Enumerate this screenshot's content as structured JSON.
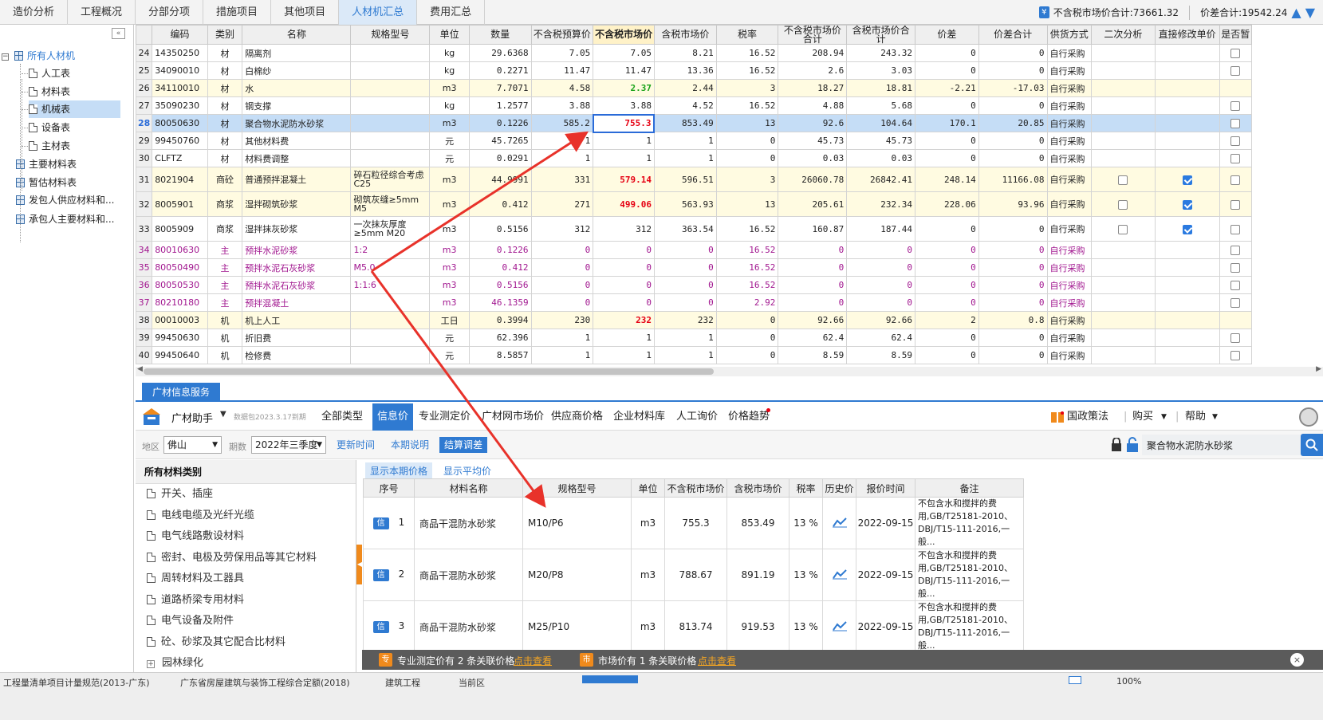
{
  "top_tabs": [
    "造价分析",
    "工程概况",
    "分部分项",
    "措施项目",
    "其他项目",
    "人材机汇总",
    "费用汇总"
  ],
  "active_top_tab": "人材机汇总",
  "totals": {
    "icon": "¥",
    "pre_tax_label": "不含税市场价合计:73661.32",
    "diff_label": "价差合计:19542.24"
  },
  "tree": {
    "collapse": "«",
    "items": [
      {
        "label": "所有人材机",
        "level": 0,
        "root": true,
        "toggle": "−"
      },
      {
        "label": "人工表",
        "level": 1
      },
      {
        "label": "材料表",
        "level": 1
      },
      {
        "label": "机械表",
        "level": 1,
        "selected": true
      },
      {
        "label": "设备表",
        "level": 1
      },
      {
        "label": "主材表",
        "level": 1
      },
      {
        "label": "主要材料表",
        "level": 0
      },
      {
        "label": "暂估材料表",
        "level": 0
      },
      {
        "label": "发包人供应材料和...",
        "level": 0
      },
      {
        "label": "承包人主要材料和...",
        "level": 0
      }
    ]
  },
  "grid": {
    "headers": [
      "",
      "编码",
      "类别",
      "名称",
      "规格型号",
      "单位",
      "数量",
      "不含税预算价",
      "不含税市场价",
      "含税市场价",
      "税率",
      "不含税市场价合计",
      "含税市场价合计",
      "价差",
      "价差合计",
      "供货方式",
      "二次分析",
      "直接修改单价",
      "是否暂"
    ],
    "rows": [
      {
        "n": "24",
        "code": "14350250",
        "cat": "材",
        "name": "隔离剂",
        "spec": "",
        "unit": "kg",
        "qty": "29.6368",
        "bud": "7.05",
        "mkt": "7.05",
        "tmkt": "8.21",
        "tax": "16.52",
        "sum": "208.94",
        "tsum": "243.32",
        "diff": "0",
        "dsum": "0",
        "supply": "自行采购",
        "cb2": "",
        "cb3": "",
        "style": ""
      },
      {
        "n": "25",
        "code": "34090010",
        "cat": "材",
        "name": "白棉纱",
        "spec": "",
        "unit": "kg",
        "qty": "0.2271",
        "bud": "11.47",
        "mkt": "11.47",
        "tmkt": "13.36",
        "tax": "16.52",
        "sum": "2.6",
        "tsum": "3.03",
        "diff": "0",
        "dsum": "0",
        "supply": "自行采购",
        "cb2": "",
        "cb3": "",
        "style": ""
      },
      {
        "n": "26",
        "code": "34110010",
        "cat": "材",
        "name": "水",
        "spec": "",
        "unit": "m3",
        "qty": "7.7071",
        "bud": "4.58",
        "mkt": "2.37",
        "tmkt": "2.44",
        "tax": "3",
        "sum": "18.27",
        "tsum": "18.81",
        "diff": "-2.21",
        "dsum": "-17.03",
        "supply": "自行采购",
        "cb2": "",
        "cb3": "",
        "style": "y",
        "mk": "green"
      },
      {
        "n": "27",
        "code": "35090230",
        "cat": "材",
        "name": "钢支撑",
        "spec": "",
        "unit": "kg",
        "qty": "1.2577",
        "bud": "3.88",
        "mkt": "3.88",
        "tmkt": "4.52",
        "tax": "16.52",
        "sum": "4.88",
        "tsum": "5.68",
        "diff": "0",
        "dsum": "0",
        "supply": "自行采购",
        "cb2": "",
        "cb3": "",
        "style": ""
      },
      {
        "n": "28",
        "code": "80050630",
        "cat": "材",
        "name": "聚合物水泥防水砂浆",
        "spec": "",
        "unit": "m3",
        "qty": "0.1226",
        "bud": "585.2",
        "mkt": "755.3",
        "tmkt": "853.49",
        "tax": "13",
        "sum": "92.6",
        "tsum": "104.64",
        "diff": "170.1",
        "dsum": "20.85",
        "supply": "自行采购",
        "cb2": "",
        "cb3": "",
        "style": "sel",
        "mk": "red"
      },
      {
        "n": "29",
        "code": "99450760",
        "cat": "材",
        "name": "其他材料费",
        "spec": "",
        "unit": "元",
        "qty": "45.7265",
        "bud": "1",
        "mkt": "1",
        "tmkt": "1",
        "tax": "0",
        "sum": "45.73",
        "tsum": "45.73",
        "diff": "0",
        "dsum": "0",
        "supply": "自行采购",
        "cb2": "",
        "cb3": "",
        "style": ""
      },
      {
        "n": "30",
        "code": "CLFTZ",
        "cat": "材",
        "name": "材料费调整",
        "spec": "",
        "unit": "元",
        "qty": "0.0291",
        "bud": "1",
        "mkt": "1",
        "tmkt": "1",
        "tax": "0",
        "sum": "0.03",
        "tsum": "0.03",
        "diff": "0",
        "dsum": "0",
        "supply": "自行采购",
        "cb2": "",
        "cb3": "",
        "style": ""
      },
      {
        "n": "31",
        "code": "8021904",
        "cat": "商砼",
        "name": "普通预拌混凝土",
        "spec": "碎石粒径综合考虑 C25",
        "unit": "m3",
        "qty": "44.9991",
        "bud": "331",
        "mkt": "579.14",
        "tmkt": "596.51",
        "tax": "3",
        "sum": "26060.78",
        "tsum": "26842.41",
        "diff": "248.14",
        "dsum": "11166.08",
        "supply": "自行采购",
        "cb2": "off",
        "cb3": "on",
        "style": "y tall",
        "mk": "red"
      },
      {
        "n": "32",
        "code": "8005901",
        "cat": "商浆",
        "name": "湿拌砌筑砂浆",
        "spec": "砌筑灰缝≥5mm M5",
        "unit": "m3",
        "qty": "0.412",
        "bud": "271",
        "mkt": "499.06",
        "tmkt": "563.93",
        "tax": "13",
        "sum": "205.61",
        "tsum": "232.34",
        "diff": "228.06",
        "dsum": "93.96",
        "supply": "自行采购",
        "cb2": "off",
        "cb3": "on",
        "style": "y tall",
        "mk": "red"
      },
      {
        "n": "33",
        "code": "8005909",
        "cat": "商浆",
        "name": "湿拌抹灰砂浆",
        "spec": "一次抹灰厚度≥5mm M20",
        "unit": "m3",
        "qty": "0.5156",
        "bud": "312",
        "mkt": "312",
        "tmkt": "363.54",
        "tax": "16.52",
        "sum": "160.87",
        "tsum": "187.44",
        "diff": "0",
        "dsum": "0",
        "supply": "自行采购",
        "cb2": "off",
        "cb3": "on",
        "style": "tall"
      },
      {
        "n": "34",
        "code": "80010630",
        "cat": "主",
        "name": "预拌水泥砂浆",
        "spec": "1:2",
        "unit": "m3",
        "qty": "0.1226",
        "bud": "0",
        "mkt": "0",
        "tmkt": "0",
        "tax": "16.52",
        "sum": "0",
        "tsum": "0",
        "diff": "0",
        "dsum": "0",
        "supply": "自行采购",
        "cb2": "",
        "cb3": "",
        "style": "main"
      },
      {
        "n": "35",
        "code": "80050490",
        "cat": "主",
        "name": "预拌水泥石灰砂浆",
        "spec": "M5.0",
        "unit": "m3",
        "qty": "0.412",
        "bud": "0",
        "mkt": "0",
        "tmkt": "0",
        "tax": "16.52",
        "sum": "0",
        "tsum": "0",
        "diff": "0",
        "dsum": "0",
        "supply": "自行采购",
        "cb2": "",
        "cb3": "",
        "style": "main"
      },
      {
        "n": "36",
        "code": "80050530",
        "cat": "主",
        "name": "预拌水泥石灰砂浆",
        "spec": "1:1:6",
        "unit": "m3",
        "qty": "0.5156",
        "bud": "0",
        "mkt": "0",
        "tmkt": "0",
        "tax": "16.52",
        "sum": "0",
        "tsum": "0",
        "diff": "0",
        "dsum": "0",
        "supply": "自行采购",
        "cb2": "",
        "cb3": "",
        "style": "main"
      },
      {
        "n": "37",
        "code": "80210180",
        "cat": "主",
        "name": "预拌混凝土",
        "spec": "",
        "unit": "m3",
        "qty": "46.1359",
        "bud": "0",
        "mkt": "0",
        "tmkt": "0",
        "tax": "2.92",
        "sum": "0",
        "tsum": "0",
        "diff": "0",
        "dsum": "0",
        "supply": "自行采购",
        "cb2": "",
        "cb3": "",
        "style": "main"
      },
      {
        "n": "38",
        "code": "00010003",
        "cat": "机",
        "name": "机上人工",
        "spec": "",
        "unit": "工日",
        "qty": "0.3994",
        "bud": "230",
        "mkt": "232",
        "tmkt": "232",
        "tax": "0",
        "sum": "92.66",
        "tsum": "92.66",
        "diff": "2",
        "dsum": "0.8",
        "supply": "自行采购",
        "cb2": "",
        "cb3": "",
        "style": "y",
        "mk": "red"
      },
      {
        "n": "39",
        "code": "99450630",
        "cat": "机",
        "name": "折旧费",
        "spec": "",
        "unit": "元",
        "qty": "62.396",
        "bud": "1",
        "mkt": "1",
        "tmkt": "1",
        "tax": "0",
        "sum": "62.4",
        "tsum": "62.4",
        "diff": "0",
        "dsum": "0",
        "supply": "自行采购",
        "cb2": "",
        "cb3": "",
        "style": ""
      },
      {
        "n": "40",
        "code": "99450640",
        "cat": "机",
        "name": "检修费",
        "spec": "",
        "unit": "元",
        "qty": "8.5857",
        "bud": "1",
        "mkt": "1",
        "tmkt": "1",
        "tax": "0",
        "sum": "8.59",
        "tsum": "8.59",
        "diff": "0",
        "dsum": "0",
        "supply": "自行采购",
        "cb2": "",
        "cb3": "",
        "style": ""
      }
    ]
  },
  "service": {
    "tab": "广材信息服务",
    "app_name": "广材助手",
    "version": "数据包2023.3.17到期",
    "menu": [
      "全部类型",
      "信息价",
      "专业测定价",
      "广材网市场价",
      "供应商价格",
      "企业材料库",
      "人工询价",
      "价格趋势"
    ],
    "active_menu": "信息价",
    "right_menu": [
      "国政策法",
      "购买",
      "帮助"
    ],
    "filter": {
      "region_label": "地区",
      "region": "佛山",
      "period_label": "期数",
      "period": "2022年三季度",
      "btn_update": "更新时间",
      "btn_desc": "本期说明",
      "btn_settle": "结算调差"
    },
    "search_value": "聚合物水泥防水砂浆",
    "category_header": "所有材料类别",
    "categories": [
      "开关、插座",
      "电线电缆及光纤光缆",
      "电气线路敷设材料",
      "密封、电极及劳保用品等其它材料",
      "周转材料及工器具",
      "道路桥梁专用材料",
      "电气设备及附件",
      "砼、砂浆及其它配合比材料",
      "园林绿化"
    ],
    "price_tabs": [
      "显示本期价格",
      "显示平均价"
    ],
    "price_headers": [
      "序号",
      "材料名称",
      "规格型号",
      "单位",
      "不含税市场价",
      "含税市场价",
      "税率",
      "历史价",
      "报价时间",
      "备注"
    ],
    "price_rows": [
      {
        "badge": "信",
        "n": "1",
        "name": "商品干混防水砂浆",
        "spec": "M10/P6",
        "unit": "m3",
        "pre": "755.3",
        "tax_incl": "853.49",
        "rate": "13 %",
        "date": "2022-09-15",
        "note": "不包含水和搅拌的费用,GB/T25181-2010、DBJ/T15-111-2016,一般..."
      },
      {
        "badge": "信",
        "n": "2",
        "name": "商品干混防水砂浆",
        "spec": "M20/P8",
        "unit": "m3",
        "pre": "788.67",
        "tax_incl": "891.19",
        "rate": "13 %",
        "date": "2022-09-15",
        "note": "不包含水和搅拌的费用,GB/T25181-2010、DBJ/T15-111-2016,一般..."
      },
      {
        "badge": "信",
        "n": "3",
        "name": "商品干混防水砂浆",
        "spec": "M25/P10",
        "unit": "m3",
        "pre": "813.74",
        "tax_incl": "919.53",
        "rate": "13 %",
        "date": "2022-09-15",
        "note": "不包含水和搅拌的费用,GB/T25181-2010、DBJ/T15-111-2016,一般..."
      }
    ],
    "info_bar": {
      "b1": "专",
      "t1": "专业测定价有 2 条关联价格",
      "l1": "点击查看",
      "b2": "市",
      "t2": "市场价有 1 条关联价格",
      "l2": "点击查看",
      "close": "×"
    }
  },
  "status_bar": [
    "工程量清单项目计量规范(2013-广东)",
    "广东省房屋建筑与装饰工程综合定额(2018)",
    "建筑工程",
    "当前区",
    "",
    "",
    "100%"
  ],
  "colors": {
    "accent": "#2f7ad1",
    "arrow": "#e8322a",
    "selected_row": "#c5ddf6",
    "price_red": "#e60012",
    "main_purple": "#a1168f"
  }
}
